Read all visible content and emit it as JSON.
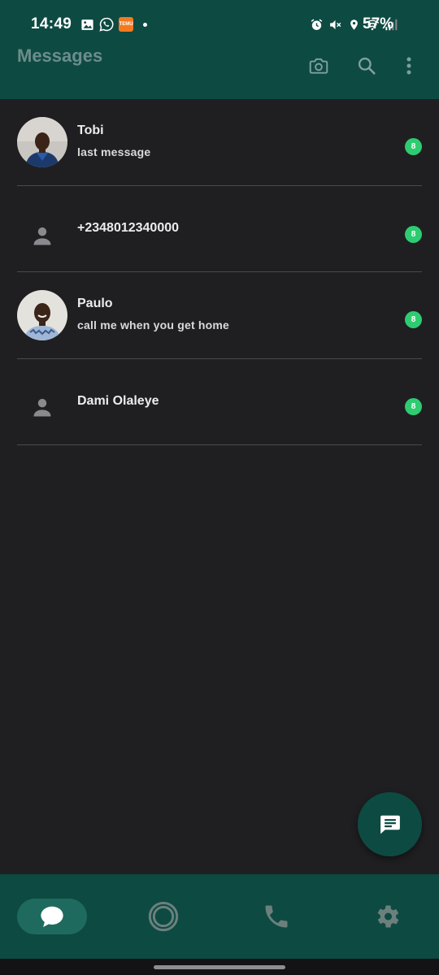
{
  "status_bar": {
    "time": "14:49",
    "battery": "57%",
    "left_icons": [
      "gallery-icon",
      "whatsapp-icon",
      "temu-icon"
    ],
    "temu_text": "TEMU",
    "right_icons": [
      "alarm-icon",
      "mute-icon",
      "location-icon",
      "wifi-icon",
      "signal-icon"
    ]
  },
  "app_bar": {
    "title": "Messages",
    "actions": [
      "camera-icon",
      "search-icon",
      "more-vert-icon"
    ]
  },
  "conversations": [
    {
      "name": "Tobi",
      "preview": "last message",
      "unread": "8",
      "avatar": "photo"
    },
    {
      "name": "+2348012340000",
      "preview": "",
      "unread": "8",
      "avatar": "placeholder"
    },
    {
      "name": "Paulo",
      "preview": "call me when you get home",
      "unread": "8",
      "avatar": "photo"
    },
    {
      "name": "Dami Olaleye",
      "preview": "",
      "unread": "8",
      "avatar": "placeholder"
    }
  ],
  "fab": {
    "icon": "new-message-icon"
  },
  "bottom_nav": {
    "items": [
      "chats-icon",
      "status-icon",
      "calls-icon",
      "settings-icon"
    ],
    "active": "chats-icon"
  },
  "colors": {
    "primary": "#0d4a42",
    "background": "#1f1f22",
    "badge": "#2ecc71",
    "active_pill": "#1f6a5e"
  }
}
